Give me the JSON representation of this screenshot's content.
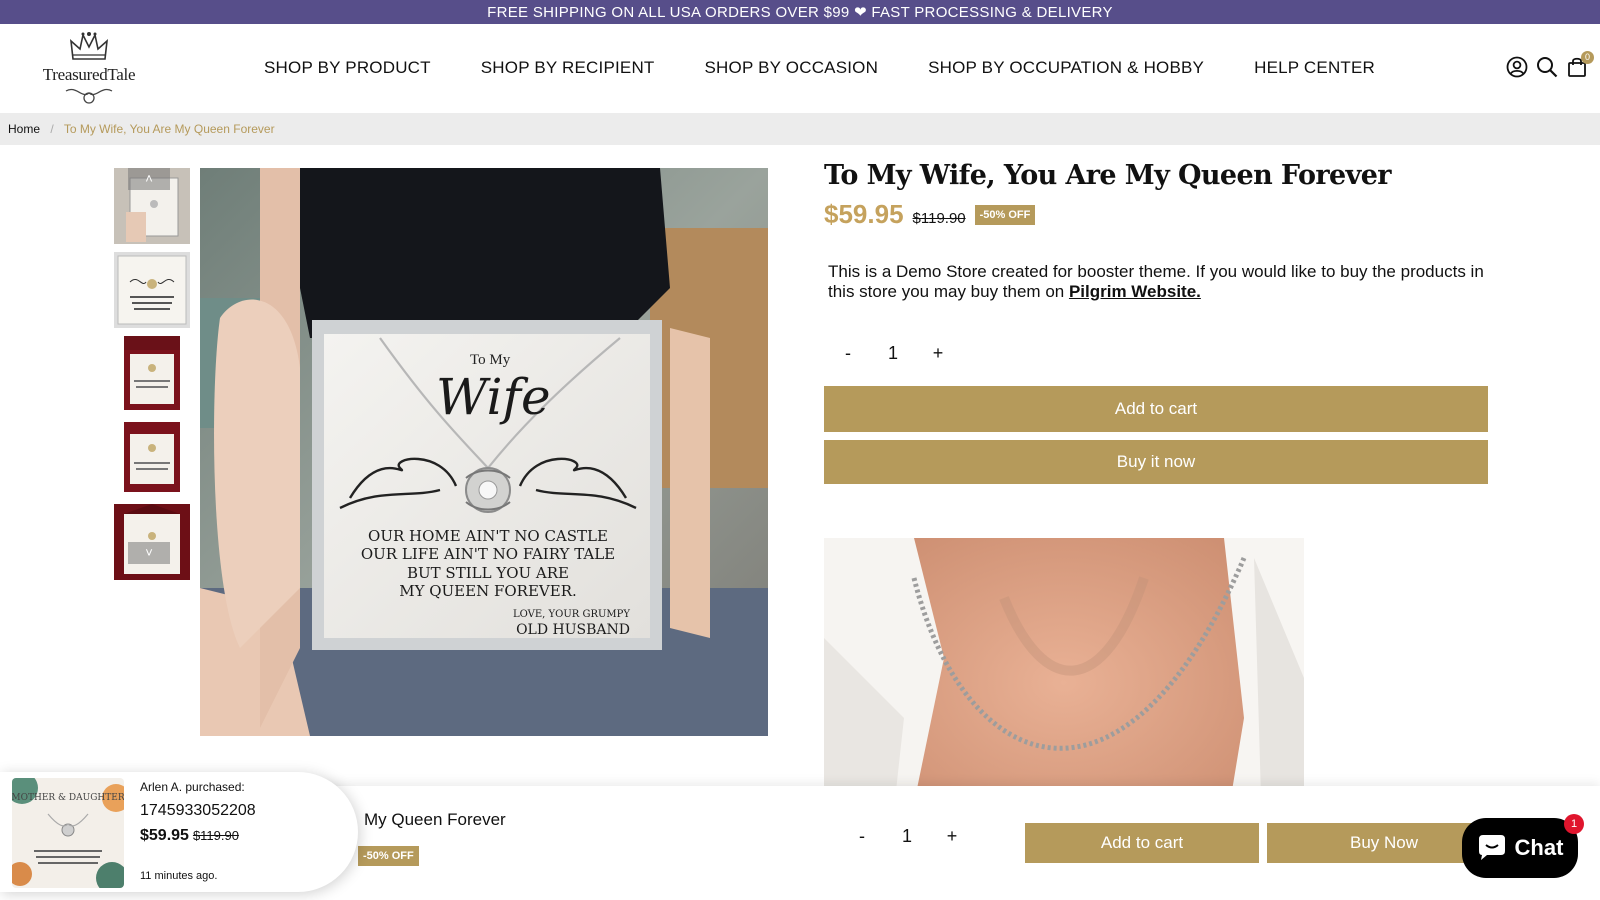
{
  "announcement": "FREE SHIPPING ON ALL USA ORDERS OVER $99 ❤ FAST PROCESSING & DELIVERY",
  "brand": "TreasuredTale",
  "nav": [
    {
      "label": "SHOP BY PRODUCT"
    },
    {
      "label": "SHOP BY RECIPIENT"
    },
    {
      "label": "SHOP BY OCCASION"
    },
    {
      "label": "SHOP BY OCCUPATION & HOBBY"
    },
    {
      "label": "HELP CENTER"
    }
  ],
  "cart_count": "0",
  "breadcrumb": {
    "home": "Home",
    "separator": "/",
    "current": "To My Wife, You Are My Queen Forever"
  },
  "thumbnail_arrows": {
    "up": "˄",
    "down": "˅"
  },
  "product": {
    "title": "To My Wife, You Are My Queen Forever",
    "price": "$59.95",
    "compare_price": "$119.90",
    "badge": "-50% OFF",
    "description_prefix": "This is a Demo Store created for booster theme. If you would like to buy the products in this store you may buy them on ",
    "description_link": "Pilgrim Website.",
    "quantity": "1",
    "minus": "-",
    "plus": "+",
    "add_to_cart": "Add to cart",
    "buy_now": "Buy it now"
  },
  "card_text": {
    "to_my": "To My",
    "wife": "Wife",
    "line1": "OUR HOME AIN'T NO CASTLE",
    "line2": "OUR LIFE AIN'T NO FAIRY TALE",
    "line3": "BUT STILL YOU ARE",
    "line4": "MY QUEEN FOREVER.",
    "sign1": "LOVE, YOUR GRUMPY",
    "sign2": "OLD HUSBAND"
  },
  "sticky_bar": {
    "title": "My Queen Forever",
    "badge": "-50% OFF",
    "quantity": "1",
    "minus": "-",
    "plus": "+",
    "add_to_cart": "Add to cart",
    "buy_now": "Buy Now"
  },
  "sales_popup": {
    "who": "Arlen A. purchased:",
    "product": "1745933052208",
    "price": "$59.95",
    "compare_price": "$119.90",
    "time": "11 minutes ago.",
    "image_text": "MOTHER & DAUGHTER"
  },
  "chat": {
    "label": "Chat",
    "badge": "1"
  },
  "colors": {
    "accent": "#b59a5b",
    "announce_bg": "#574e8a",
    "price": "#c5a25d",
    "chat_badge": "#e0152d"
  }
}
